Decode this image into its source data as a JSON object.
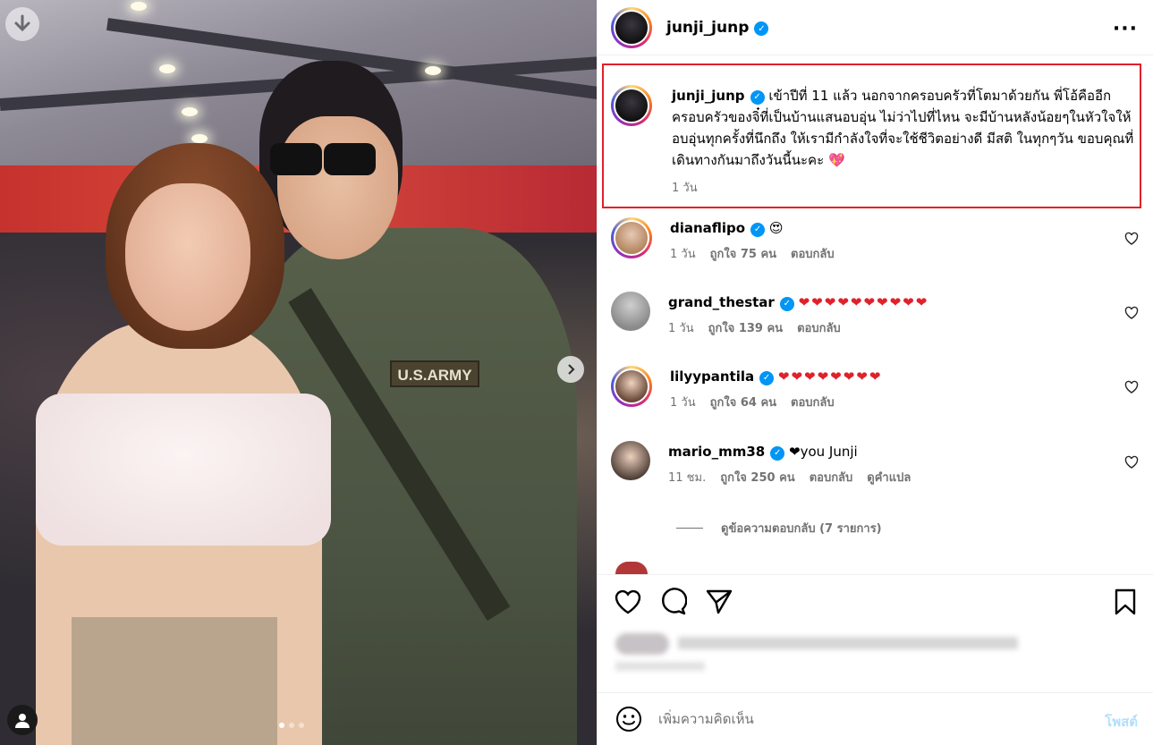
{
  "photo": {
    "patch_text": "U.S.ARMY",
    "download_icon": "arrow-down-icon",
    "next_icon": "chevron-right-icon",
    "carousel_dots": 3,
    "carousel_active": 1
  },
  "post": {
    "username": "junji_junp",
    "more_icon": "more-options-icon"
  },
  "caption": {
    "username": "junji_junp",
    "text": "เข้าปีที่ 11 แล้ว นอกจากครอบครัวที่โตมาด้วยกัน พี่โอ้คืออีกครอบครัวของจิ๋ที่เป็นบ้านแสนอบอุ่น ไม่ว่าไปที่ไหน จะมีบ้านหลังน้อยๆในหัวใจให้อบอุ่นทุกครั้งที่นึกถึง ให้เรามีกำลังใจที่จะใช้ชีวิตอย่างดี มีสติ ในทุกๆวัน ขอบคุณที่เดินทางกันมาถึงวันนี้นะคะ",
    "emoji": "💖",
    "time": "1 วัน"
  },
  "comments": [
    {
      "username": "dianaflipo",
      "text": "😍",
      "time": "1 วัน",
      "likes": "ถูกใจ 75 คน",
      "reply": "ตอบกลับ",
      "translate": ""
    },
    {
      "username": "grand_thestar",
      "text": "❤❤❤❤❤❤❤❤❤❤",
      "time": "1 วัน",
      "likes": "ถูกใจ 139 คน",
      "reply": "ตอบกลับ",
      "translate": ""
    },
    {
      "username": "lilyypantila",
      "text": "❤❤❤❤❤❤❤❤",
      "time": "1 วัน",
      "likes": "ถูกใจ 64 คน",
      "reply": "ตอบกลับ",
      "translate": ""
    },
    {
      "username": "mario_mm38",
      "text": "❤you Junji",
      "time": "11 ชม.",
      "likes": "ถูกใจ 250 คน",
      "reply": "ตอบกลับ",
      "translate": "ดูคำแปล"
    }
  ],
  "view_replies": "ดูข้อความตอบกลับ (7 รายการ)",
  "actions": {
    "like_icon": "heart-icon",
    "comment_icon": "comment-icon",
    "share_icon": "send-icon",
    "save_icon": "bookmark-icon"
  },
  "add_comment": {
    "placeholder": "เพิ่มความคิดเห็น",
    "post_label": "โพสต์",
    "emoji_icon": "smiley-icon"
  },
  "colors": {
    "verified": "#0095f6",
    "highlight_border": "#e0212a",
    "post_button_disabled": "#b2dffc",
    "meta_text": "#737373"
  }
}
